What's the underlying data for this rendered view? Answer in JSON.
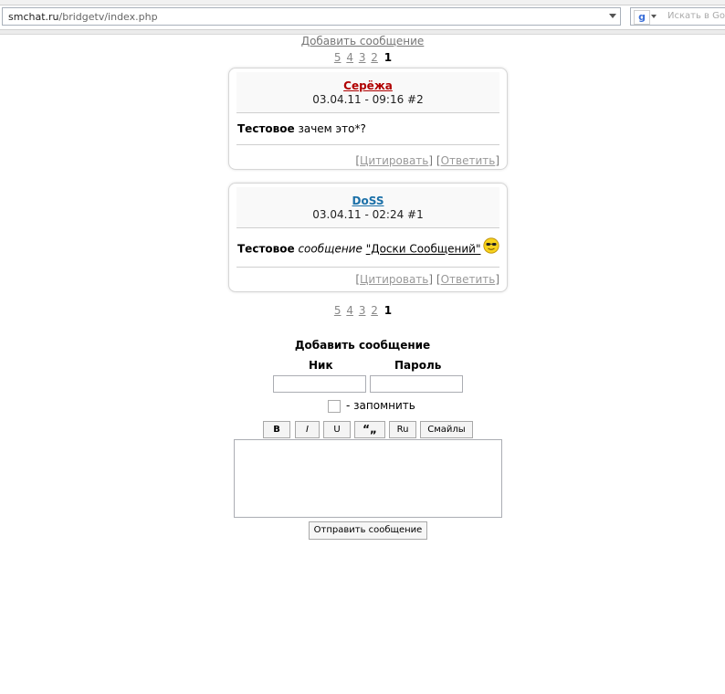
{
  "browser": {
    "url_host": "smchat.ru",
    "url_path": "/bridgetv/index.php",
    "search_placeholder": "Искать в Go",
    "search_engine_icon": "google-g-icon"
  },
  "page": {
    "add_message_link": "Добавить сообщение",
    "pagination": {
      "pages": [
        "5",
        "4",
        "3",
        "2"
      ],
      "current": "1"
    },
    "posts": [
      {
        "author": "Серёжа",
        "author_color": "#b00000",
        "date": "03.04.11 - 09:16",
        "number": "#2",
        "body_bold": "Тестовое",
        "body_rest": "зачем это*?",
        "quote_label": "Цитировать",
        "reply_label": "Ответить"
      },
      {
        "author": "DoSS",
        "author_color": "#1b70a8",
        "date": "03.04.11 - 02:24",
        "number": "#1",
        "body_bold": "Тестовое",
        "body_italic": "сообщение",
        "body_link": "\"Доски Сообщений\"",
        "body_icon": "cool-smiley-icon",
        "quote_label": "Цитировать",
        "reply_label": "Ответить"
      }
    ],
    "form": {
      "title": "Добавить сообщение",
      "nick_label": "Ник",
      "password_label": "Пароль",
      "nick_value": "",
      "password_value": "",
      "remember_label": "- запомнить",
      "toolbar": {
        "bold": "B",
        "italic": "I",
        "underline": "U",
        "quote": "“„",
        "ru": "Ru",
        "smileys": "Смайлы"
      },
      "message_value": "",
      "send_label": "Отправить сообщение"
    }
  }
}
